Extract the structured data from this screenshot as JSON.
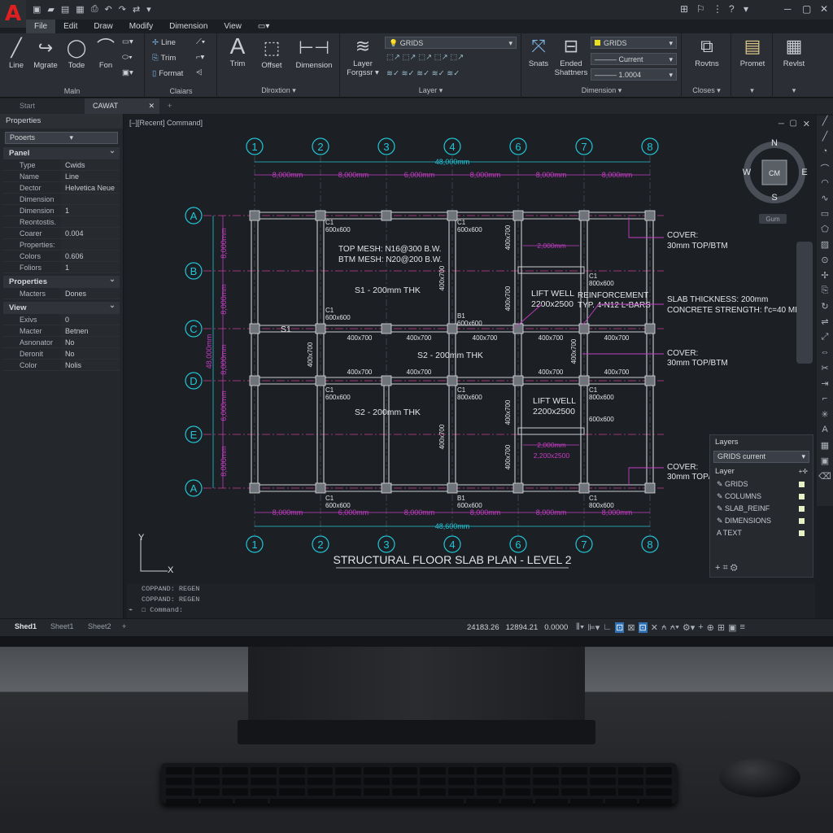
{
  "app": {
    "logo": "A",
    "quick_access": [
      "▣",
      "▰",
      "▤",
      "▦",
      "⎙",
      "↶",
      "↷",
      "⇄",
      "▾"
    ],
    "window_controls": [
      "⊞",
      "⚐",
      "⋮",
      "?",
      "▾",
      "─",
      "▢",
      "✕"
    ]
  },
  "menu": [
    "File",
    "Edit",
    "Draw",
    "Modify",
    "Dimension",
    "View"
  ],
  "ribbon": {
    "main": {
      "label": "Maln",
      "tools": [
        "Line",
        "Mgrate",
        "Tode",
        "Fon"
      ]
    },
    "clalars": {
      "label": "Claiars",
      "tools": [
        "Line",
        "Trim",
        "Format"
      ]
    },
    "direction": {
      "label": "Dlroxtion",
      "tools": [
        "Trim",
        "Offset",
        "Dimension"
      ]
    },
    "layer": {
      "label": "Layer",
      "tool": "Layer Forgssr",
      "dropdown": "GRIDS"
    },
    "dimension": {
      "label": "Dimension",
      "tools": [
        "Snats",
        "Ended Shattners"
      ],
      "dropdown": "GRIDS",
      "current": "Current",
      "scale": "1.0004"
    },
    "closes": {
      "label": "Closes",
      "tool": "Rovtns"
    },
    "promet": {
      "tool": "Promet"
    },
    "revlst": {
      "tool": "Revlst"
    }
  },
  "tabs": [
    "Start",
    "CAWAT",
    "+"
  ],
  "properties": {
    "title": "Properties",
    "selector": "Pooerts",
    "sections": [
      {
        "name": "Panel",
        "rows": [
          [
            "Type",
            "Cwids"
          ],
          [
            "Name",
            "Line"
          ],
          [
            "Dector",
            "Helvetica Neue"
          ],
          [
            "Dimension",
            ""
          ],
          [
            "Dimension",
            "1"
          ],
          [
            "Reontostis.",
            ""
          ],
          [
            "Coarer",
            "0.004"
          ],
          [
            "Properties:",
            ""
          ],
          [
            "Colors",
            "0.606"
          ],
          [
            "Foliors",
            "1"
          ]
        ]
      },
      {
        "name": "Properties",
        "rows": [
          [
            "Macters",
            "Dones"
          ]
        ]
      },
      {
        "name": "View",
        "rows": [
          [
            "Exivs",
            "0"
          ],
          [
            "Macter",
            "Betnen"
          ],
          [
            "Asnonator",
            "No"
          ],
          [
            "Deronit",
            "No"
          ],
          [
            "Color",
            "Nolis"
          ]
        ]
      }
    ]
  },
  "viewport": {
    "label": "[–][Recent] Command]"
  },
  "drawing": {
    "title": "STRUCTURAL FLOOR SLAB PLAN - LEVEL 2",
    "grid_cols": [
      "1",
      "2",
      "3",
      "4",
      "6",
      "7",
      "8"
    ],
    "grid_rows": [
      "A",
      "B",
      "C",
      "D",
      "E",
      "A"
    ],
    "bay_dims": [
      "8,000mm",
      "8,000mm",
      "6,000mm",
      "8,000mm",
      "8,000mm",
      "8,000mm"
    ],
    "bay_dims_bottom": [
      "8,000mm",
      "6,000mm",
      "8,000mm",
      "8,000mm",
      "8,000mm",
      "8,000mm"
    ],
    "overall": "48,000mm",
    "overall_bottom": "48,600mm",
    "left_dims": [
      "8,000mm",
      "8,000mm",
      "6,000mm",
      "8,000mm"
    ],
    "left_overall": "48,000mm",
    "labels": {
      "c1": "C1",
      "c1size": "600x600",
      "c1b": "C1",
      "c1bsize": "800x600",
      "top_mesh": "TOP MESH: N16@300 B.W.",
      "btm_mesh": "BTM MESH: N20@200 B.W.",
      "s1": "S1 - 200mm THK",
      "s1tag": "S1",
      "s2a": "S2 - 200mm THK",
      "s2b": "S2 - 200mm THK",
      "lift1": "LIFT WELL",
      "lift1size": "2200x2500",
      "lift2": "LIFT WELL",
      "lift2size": "2200x2500",
      "reinf1": "REINFORCEMENT",
      "reinf2": "TYP. 4-N12 L-BARS",
      "beam": "400x700",
      "beam_v": "400x700",
      "b1": "B1",
      "b1size": "600x600",
      "c1vert": "400x700",
      "dim2000a": "2,000mm",
      "dim2000b": "2,000mm",
      "dim2200": "2,200x2500",
      "cover1a": "COVER:",
      "cover1b": "30mm TOP/BTM",
      "cover2a": "COVER:",
      "cover2b": "30mm TOP/BTM",
      "cover3a": "COVER:",
      "cover3b": "30mm TOP/",
      "slab_thk": "SLAB THICKNESS: 200mm",
      "conc": "CONCRETE STRENGTH: f'c=40 MPa",
      "bot_c1": "C1",
      "bot_c1size": "600x600",
      "bot_b1": "B1",
      "bot_b1size": "600x600",
      "bot_c1b": "C1",
      "bot_c1bsize": "800x600",
      "c1t": "C1",
      "c1tsize": "800x600",
      "c1v": "600x600",
      "s1v": "400x700",
      "c1v2": "400x700"
    },
    "compass": {
      "n": "N",
      "s": "S",
      "e": "E",
      "w": "W",
      "center": "CM",
      "ucs": "Gum"
    },
    "ucs": {
      "y": "Y",
      "x": "X"
    }
  },
  "layers_panel": {
    "title": "Layers",
    "current": "GRIDS current",
    "header": "Layer",
    "items": [
      "GRIDS",
      "COLUMNS",
      "SLAB_REINF",
      "DIMENSIONS",
      "TEXT"
    ]
  },
  "command": {
    "lines": [
      "COPPAND:  REGEN",
      "COPPAND:  REGEN"
    ],
    "placeholder": "Command:"
  },
  "status": {
    "tabs": [
      "Shed1",
      "Sheet1",
      "Sheet2",
      "+"
    ],
    "coords": [
      "24183.26",
      "12894.21",
      "0.0000"
    ]
  },
  "colors": {
    "grid": "#21c6d6",
    "dim": "#c43dc4",
    "text": "#e2e4e8",
    "cad_bg": "#1c1f24"
  }
}
